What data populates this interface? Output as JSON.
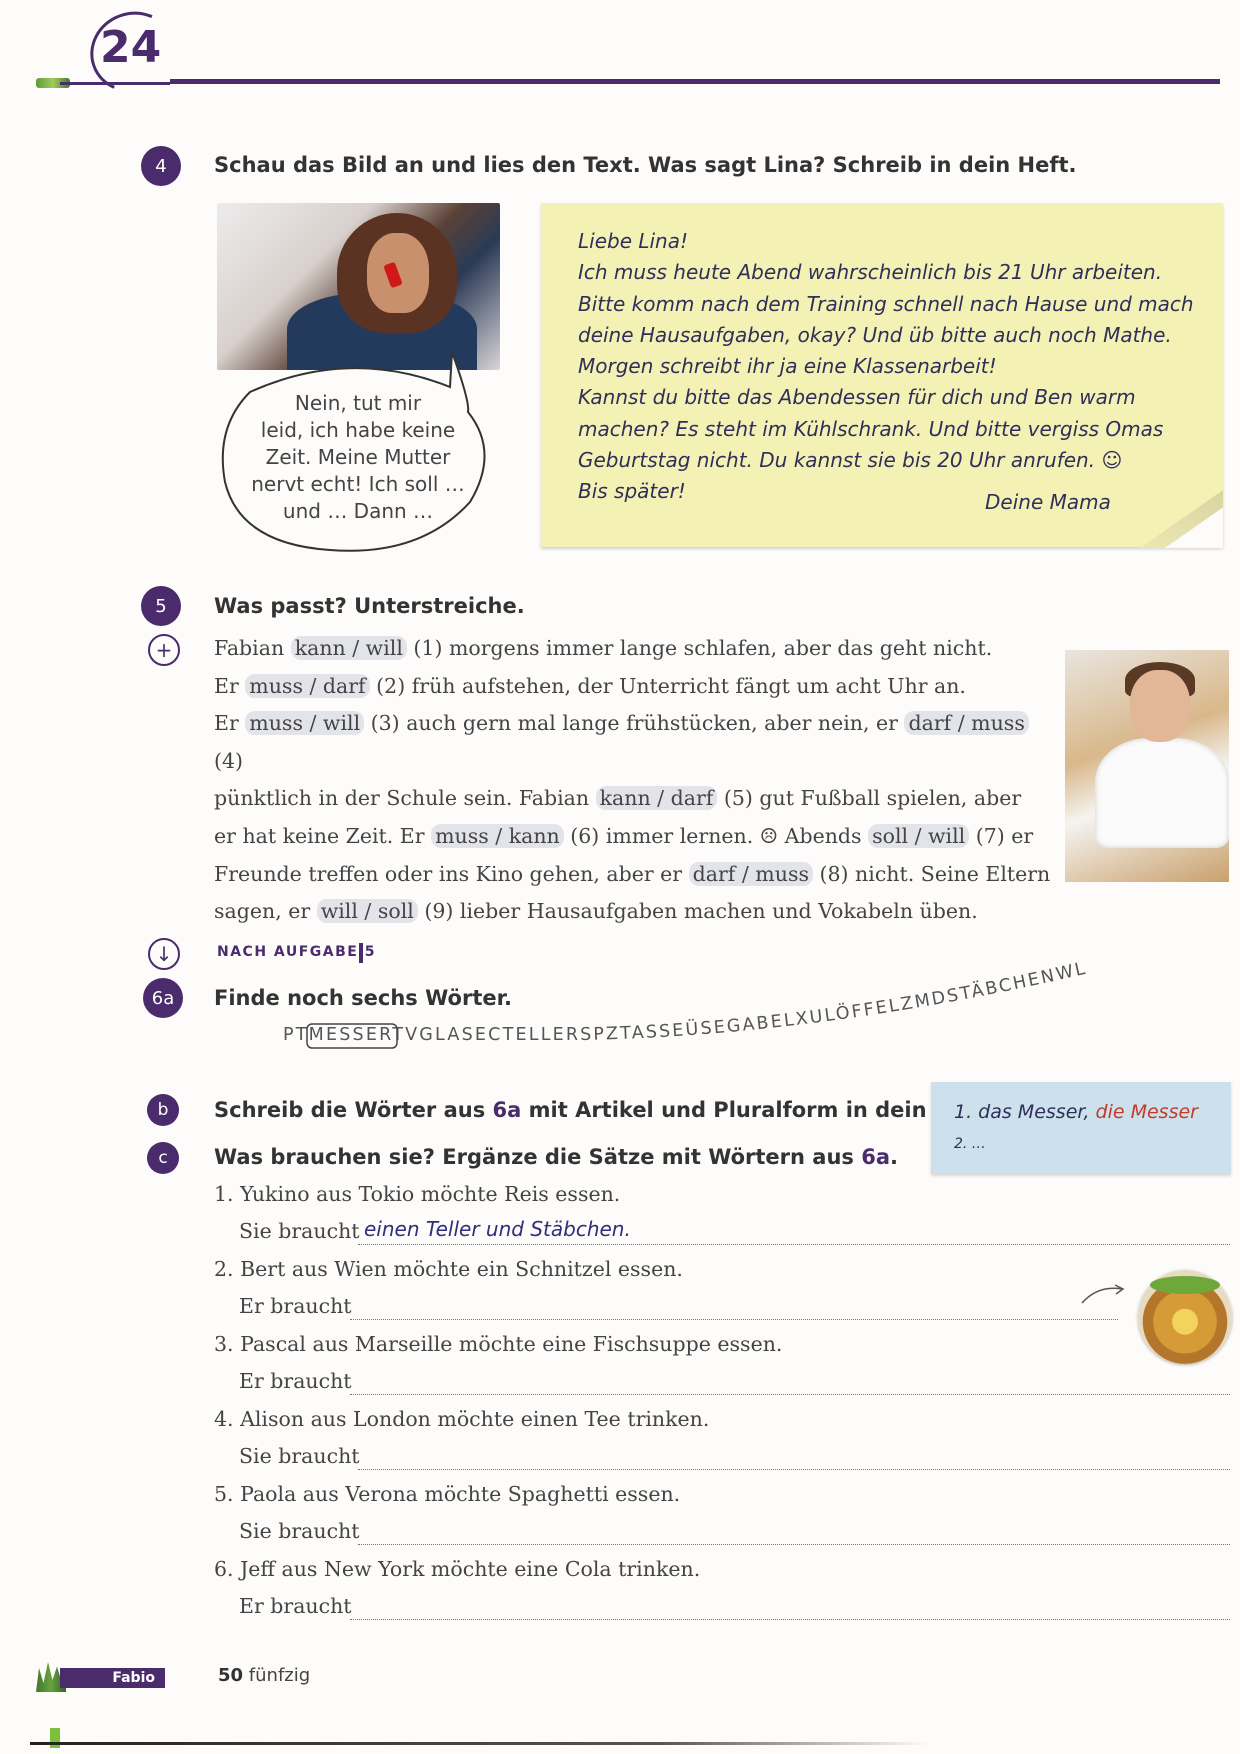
{
  "unit_number": "24",
  "exercise4": {
    "badge": "4",
    "instruction": "Schau das Bild an und lies den Text. Was sagt Lina? Schreib in dein Heft.",
    "bubble_lines": [
      "Nein, tut mir",
      "leid, ich habe keine",
      "Zeit. Meine Mutter",
      "nervt echt! Ich soll …",
      "und … Dann …"
    ],
    "note_lines": [
      "Liebe Lina!",
      "Ich muss heute Abend wahrscheinlich bis 21 Uhr arbeiten.",
      "Bitte komm nach dem Training schnell nach Hause und mach",
      "deine Hausaufgaben, okay? Und üb bitte auch noch Mathe.",
      "Morgen schreibt ihr ja eine Klassenarbeit!",
      "Kannst du bitte das Abendessen für dich und Ben warm",
      "machen? Es steht im Kühlschrank. Und bitte vergiss Omas",
      "Geburtstag nicht. Du kannst sie bis 20 Uhr anrufen. ☺",
      "Bis später!"
    ],
    "note_sign": "Deine Mama"
  },
  "exercise5": {
    "badge": "5",
    "instruction": "Was passt? Unterstreiche.",
    "lines": [
      [
        {
          "t": "Fabian "
        },
        {
          "o": "kann / will"
        },
        {
          "t": " (1) morgens immer lange schlafen, aber das geht nicht."
        }
      ],
      [
        {
          "t": "Er "
        },
        {
          "o": "muss / darf"
        },
        {
          "t": " (2) früh aufstehen, der Unterricht fängt um acht Uhr an."
        }
      ],
      [
        {
          "t": "Er "
        },
        {
          "o": "muss / will"
        },
        {
          "t": " (3) auch gern mal lange frühstücken, aber nein, er "
        },
        {
          "o": "darf / muss"
        },
        {
          "t": " (4)"
        }
      ],
      [
        {
          "t": "pünktlich in der Schule sein. Fabian "
        },
        {
          "o": "kann / darf"
        },
        {
          "t": " (5) gut Fußball spielen, aber"
        }
      ],
      [
        {
          "t": "er hat keine Zeit. Er "
        },
        {
          "o": "muss / kann"
        },
        {
          "t": " (6) immer lernen. ☹ Abends "
        },
        {
          "o": "soll / will"
        },
        {
          "t": " (7) er"
        }
      ],
      [
        {
          "t": "Freunde treffen oder ins Kino gehen, aber er "
        },
        {
          "o": "darf / muss"
        },
        {
          "t": " (8) nicht. Seine Eltern"
        }
      ],
      [
        {
          "t": "sagen, er "
        },
        {
          "o": "will / soll"
        },
        {
          "t": " (9) lieber Hausaufgaben machen und Vokabeln üben."
        }
      ]
    ]
  },
  "nach_aufgabe": "NACH AUFGABE 5",
  "exercise6a": {
    "badge": "6a",
    "instruction": "Finde noch sechs Wörter.",
    "prefix": "PT",
    "boxed": "MESSER",
    "rest": "TVGLASECTELLERSPZTASSEÜSEGABELXULÖFFELZMDSTÄBCHENWL"
  },
  "exercise6b": {
    "badge": "b",
    "instruction_pre": "Schreib die Wörter aus ",
    "instruction_ref": "6a",
    "instruction_post": " mit Artikel und Pluralform in dein Heft.",
    "tip_line1_a": "1. das Messer, ",
    "tip_line1_b": "die Messer",
    "tip_line2": "2. …"
  },
  "exercise6c": {
    "badge": "c",
    "instruction_pre": "Was brauchen sie? Ergänze die Sätze mit Wörtern aus ",
    "instruction_ref": "6a",
    "instruction_post": ".",
    "items": [
      {
        "q": "1. Yukino aus Tokio möchte Reis essen.",
        "a": "Sie braucht",
        "answer": "einen Teller und Stäbchen."
      },
      {
        "q": "2. Bert aus Wien möchte ein Schnitzel essen.",
        "a": "Er braucht",
        "answer": ""
      },
      {
        "q": "3. Pascal aus Marseille möchte eine Fischsuppe essen.",
        "a": "Er braucht",
        "answer": ""
      },
      {
        "q": "4. Alison aus London möchte einen Tee trinken.",
        "a": "Sie braucht",
        "answer": ""
      },
      {
        "q": "5. Paola aus Verona möchte Spaghetti essen.",
        "a": "Sie braucht",
        "answer": ""
      },
      {
        "q": "6. Jeff aus New York möchte eine Cola trinken.",
        "a": "Er braucht",
        "answer": ""
      }
    ]
  },
  "footer": {
    "tag": "Fabio",
    "page_number": "50",
    "page_word": "fünfzig"
  }
}
